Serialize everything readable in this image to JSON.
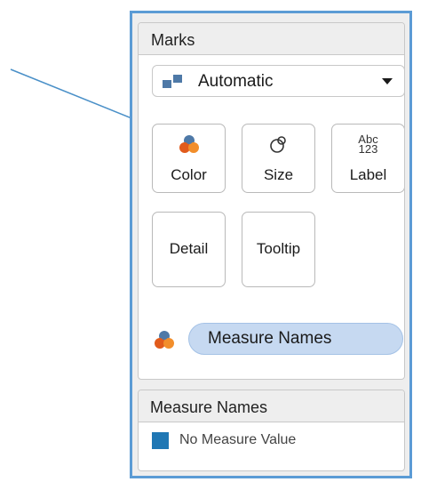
{
  "marks": {
    "header": "Marks",
    "mark_type": {
      "selected": "Automatic",
      "icon": "automatic-bars-icon"
    },
    "buttons": [
      {
        "label": "Color",
        "icon": "color-circles-icon"
      },
      {
        "label": "Size",
        "icon": "size-circles-icon"
      },
      {
        "label": "Label",
        "icon": "abc-123-icon",
        "icon_text_top": "Abc",
        "icon_text_bottom": "123"
      },
      {
        "label": "Detail"
      },
      {
        "label": "Tooltip"
      }
    ],
    "shelf": {
      "encoding_icon": "color-circles-icon",
      "pill_label": "Measure Names"
    }
  },
  "legend": {
    "header": "Measure Names",
    "items": [
      {
        "label": "No Measure Value",
        "color": "#1f77b4"
      }
    ]
  },
  "colors": {
    "frame_accent": "#5b9bd5",
    "pill_fill": "#c6d9f1",
    "annotation_arrow": "#4a90c8",
    "color_icon_blue": "#4e79a7",
    "color_icon_orange": "#e15b1c"
  }
}
